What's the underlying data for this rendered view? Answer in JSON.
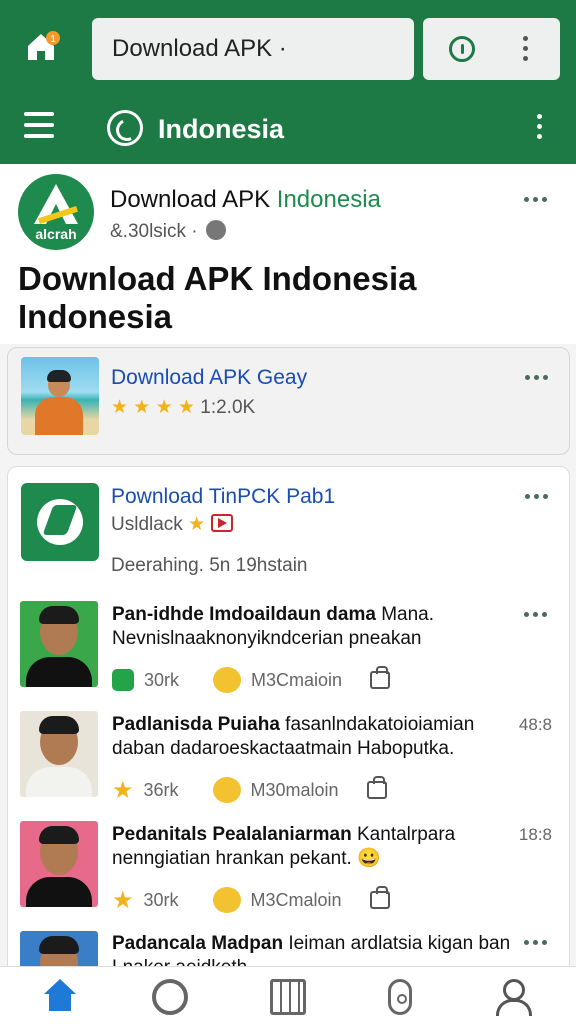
{
  "browser": {
    "url_text": "Download APK ·",
    "home_icon": "home-badge-icon",
    "tab_icon": "tab-switcher-icon",
    "menu_icon": "more-vertical-icon"
  },
  "nav": {
    "title": "Indonesia",
    "menu_icon": "hamburger-icon",
    "logo_icon": "site-logo-icon",
    "more_icon": "more-vertical-icon"
  },
  "profile": {
    "logo_text": "alcrah",
    "name_prefix": "Download APK ",
    "name_highlight": "Indonesia",
    "subtitle": "&.30lsick ·",
    "headline": "Download APK Indonesia Indonesia"
  },
  "featured_card": {
    "title": "Download APK Geay",
    "stars": "★ ★ ★ ★",
    "rating": "1:2.0K"
  },
  "app_card": {
    "title": "Pownload TinPCK Pab1",
    "subtitle": "Usldlack",
    "badge_star": "★",
    "meta": "Deerahing. 5n 19hstain"
  },
  "feed": [
    {
      "title_bold": "Pan-idhde Imdoaildaun dama",
      "title_rest": " Mana. Nevnislnaaknonyikndcerian pneakan",
      "time": "",
      "action1_icon": "chat-bubble-icon",
      "action1_count": "30rk",
      "action2_count": "M3Cmaioin",
      "avatar_bg": "#3aa84a"
    },
    {
      "title_bold": "Padlanisda Puiaha",
      "title_rest": " fasanlndakatoioiamian daban dadaroeskactaatmain Haboputka.",
      "time": "48:8",
      "action1_icon": "star-icon",
      "action1_count": "36rk",
      "action2_count": "M30maloin",
      "avatar_bg": "#e8e4da"
    },
    {
      "title_bold": "Pedanitals Pealalaniarman",
      "title_rest": " Kantalrpara nenngiatian hrankan pekant. 😀",
      "time": "18:8",
      "action1_icon": "star-icon",
      "action1_count": "30rk",
      "action2_count": "M3Cmaloin",
      "avatar_bg": "#e86a8a"
    },
    {
      "title_bold": "Padancala Madpan",
      "title_rest": " Ieiman ardlatsia kigan ban Lnaker aeidketh",
      "time": "",
      "action1_icon": "",
      "action1_count": "",
      "action2_count": "",
      "avatar_bg": "#3a7ec8"
    }
  ],
  "bottom_nav": [
    "home-icon",
    "refresh-icon",
    "apps-grid-icon",
    "remote-icon",
    "profile-icon"
  ],
  "colors": {
    "brand_green": "#1e7a45",
    "link_blue": "#1a4db3",
    "star_yellow": "#f2b21a",
    "active_blue": "#1e7ad6"
  }
}
